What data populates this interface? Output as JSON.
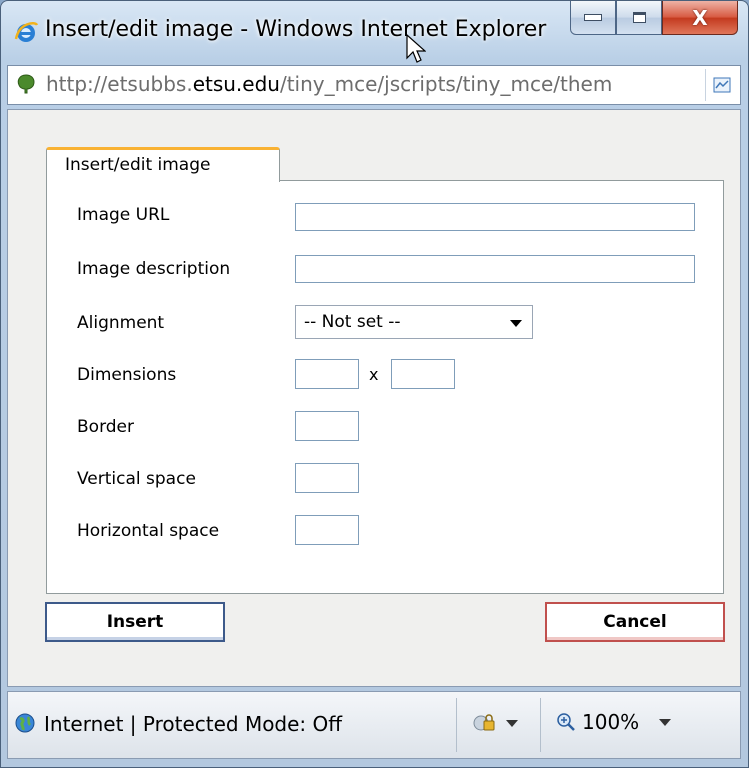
{
  "window": {
    "title": "Insert/edit image - Windows Internet Explorer",
    "close_glyph": "X"
  },
  "address_bar": {
    "url_prefix": "http://etsubbs.",
    "url_domain": "etsu.edu",
    "url_path": "/tiny_mce/jscripts/tiny_mce/them"
  },
  "dialog": {
    "tab_label": "Insert/edit image",
    "fields": {
      "image_url_label": "Image URL",
      "image_url_value": "",
      "image_description_label": "Image description",
      "image_description_value": "",
      "alignment_label": "Alignment",
      "alignment_value": "-- Not set --",
      "dimensions_label": "Dimensions",
      "dimensions_separator": "x",
      "width_value": "",
      "height_value": "",
      "border_label": "Border",
      "border_value": "",
      "vertical_space_label": "Vertical space",
      "vertical_space_value": "",
      "horizontal_space_label": "Horizontal space",
      "horizontal_space_value": ""
    },
    "buttons": {
      "insert_label": "Insert",
      "cancel_label": "Cancel"
    }
  },
  "status_bar": {
    "zone_text": "Internet | Protected Mode: Off",
    "zoom_text": "100%"
  },
  "icons": {
    "browser": "internet-explorer-icon",
    "site": "site-favicon-icon",
    "compat": "compatibility-view-icon",
    "zone": "globe-icon",
    "security": "security-icon",
    "zoom": "zoom-icon"
  }
}
